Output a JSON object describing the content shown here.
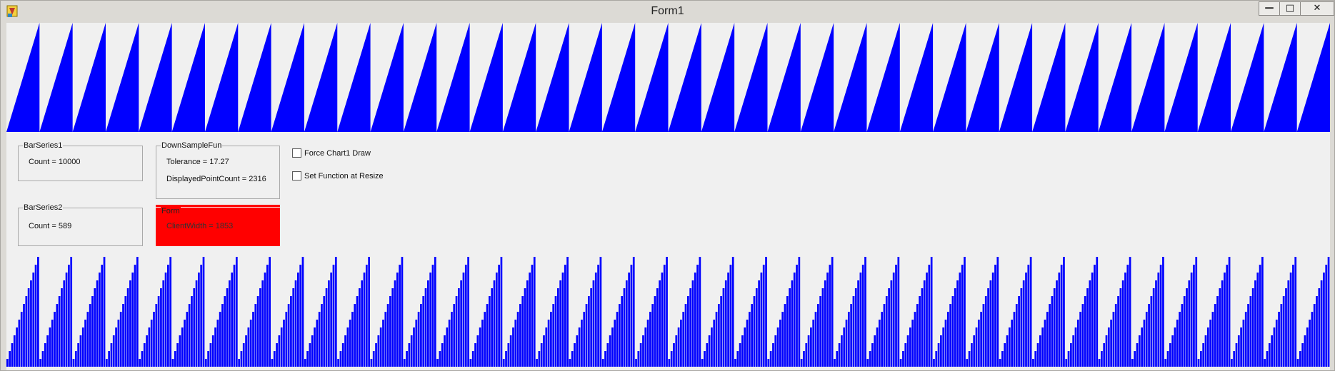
{
  "window": {
    "title": "Form1",
    "icon": "delphi-app-icon",
    "buttons": {
      "minimize": "—",
      "maximize": "□",
      "close": "✕"
    }
  },
  "colors": {
    "series": "#0000ff",
    "highlight": "#ff0000",
    "background": "#f0f0f0"
  },
  "groups": {
    "barseries1": {
      "title": "BarSeries1",
      "lines": [
        "Count = 10000"
      ]
    },
    "downsamplefun": {
      "title": "DownSampleFun",
      "lines": [
        "Tolerance = 17.27",
        "DisplayedPointCount = 2316"
      ]
    },
    "barseries2": {
      "title": "BarSeries2",
      "lines": [
        "Count = 589"
      ]
    },
    "form": {
      "title": "Form",
      "lines": [
        "ClientWidth = 1853"
      ]
    }
  },
  "checkboxes": [
    {
      "label": "Force Chart1 Draw",
      "checked": false
    },
    {
      "label": "Set Function at Resize",
      "checked": false
    }
  ],
  "chart_data": [
    {
      "type": "area",
      "title": "",
      "series": [
        {
          "values_pattern": "sawtooth",
          "cycles": 40,
          "min": 0,
          "max": 1
        }
      ],
      "count": 10000,
      "grid": false
    },
    {
      "type": "bar",
      "title": "",
      "series": [
        {
          "values_pattern": "stepped sawtooth",
          "cycles": 40,
          "steps_per_cycle": 14,
          "min": 0,
          "max": 1
        }
      ],
      "count": 589,
      "grid": false
    }
  ]
}
